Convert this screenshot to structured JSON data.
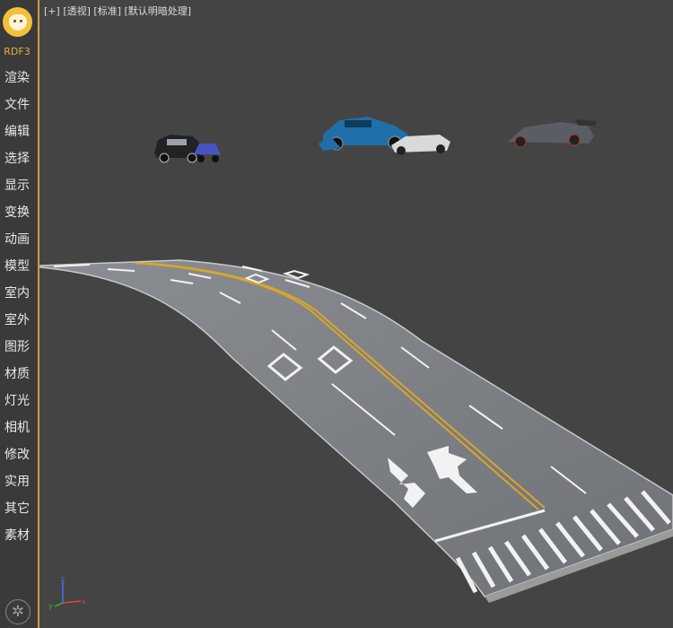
{
  "app": {
    "brand": "RDF3"
  },
  "viewport": {
    "label_plus": "[+]",
    "label_view": "[透视]",
    "label_shading": "[标准]",
    "label_light": "[默认明暗处理]"
  },
  "menu": [
    {
      "label": "渲染"
    },
    {
      "label": "文件"
    },
    {
      "label": "编辑"
    },
    {
      "label": "选择"
    },
    {
      "label": "显示"
    },
    {
      "label": "变换"
    },
    {
      "label": "动画"
    },
    {
      "label": "模型"
    },
    {
      "label": "室内"
    },
    {
      "label": "室外"
    },
    {
      "label": "图形"
    },
    {
      "label": "材质"
    },
    {
      "label": "灯光"
    },
    {
      "label": "相机"
    },
    {
      "label": "修改"
    },
    {
      "label": "实用"
    },
    {
      "label": "其它"
    },
    {
      "label": "素材"
    }
  ],
  "icons": {
    "logo": "bear-face-icon",
    "settings": "gear-icon"
  },
  "colors": {
    "accent": "#e2b340",
    "viewport_bg": "#444444",
    "sidebar_bg": "#3a3a3a",
    "road": "#7c7f84",
    "lane_yellow": "#d9a52a"
  },
  "gizmo": {
    "x": "x",
    "y": "y",
    "z": "z"
  }
}
